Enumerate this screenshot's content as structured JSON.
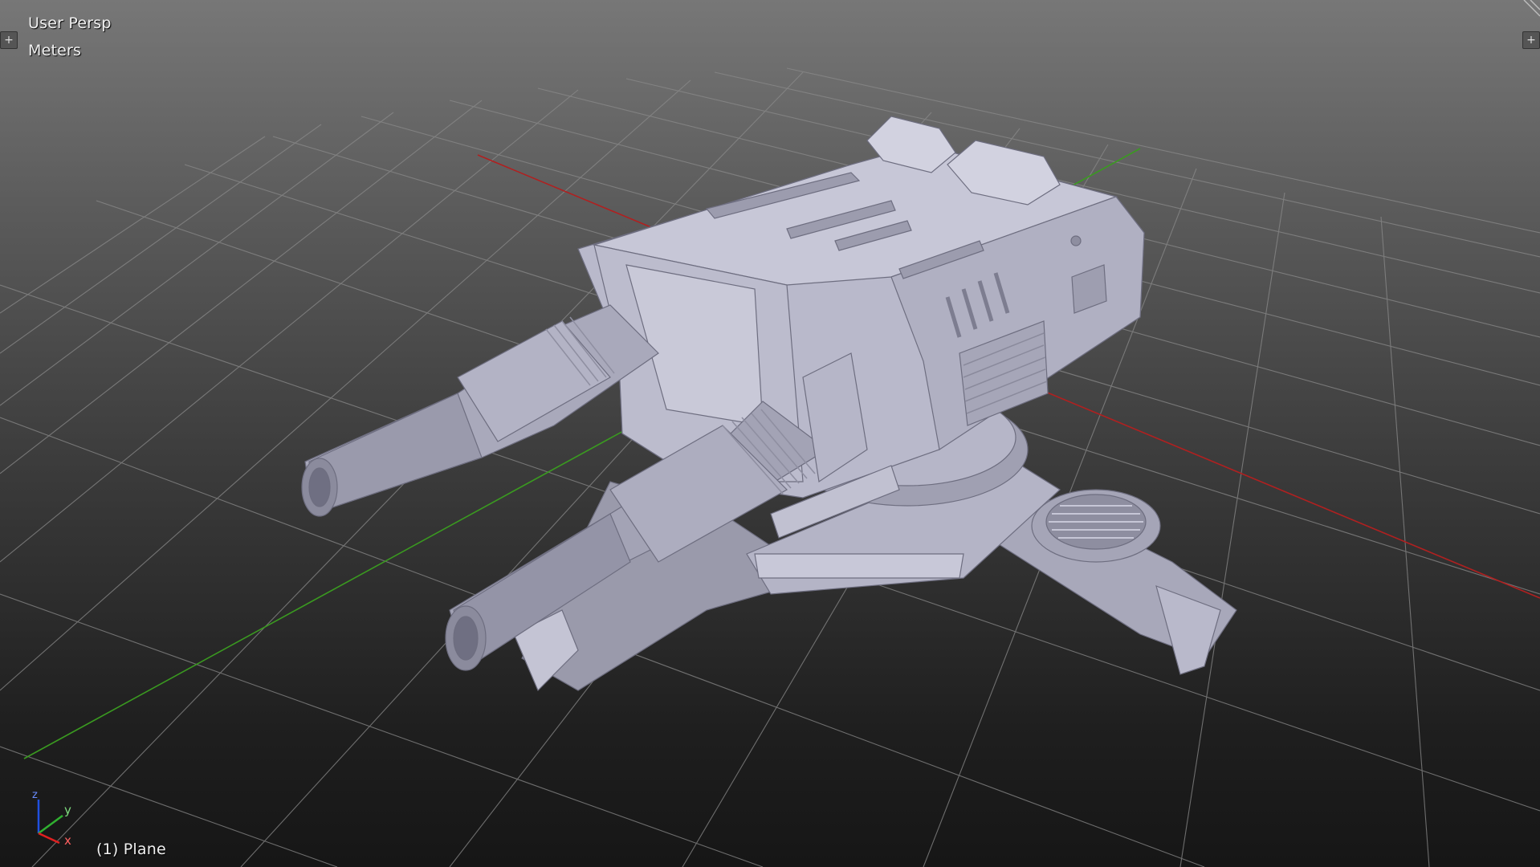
{
  "viewport": {
    "view_name": "User Persp",
    "units": "Meters",
    "object_name": "(1) Plane",
    "background_top": "#777777",
    "background_bottom": "#161616",
    "grid_color": "#8a8a8a",
    "x_axis_color": "#b02020",
    "y_axis_color": "#3a9a20",
    "model_color": "#b7b7c9"
  },
  "axis_widget": {
    "x_label": "x",
    "y_label": "y",
    "z_label": "z"
  },
  "icons": [
    "split-area-plus-icon",
    "corner-hatch-icon",
    "axis-gizmo-icon"
  ]
}
